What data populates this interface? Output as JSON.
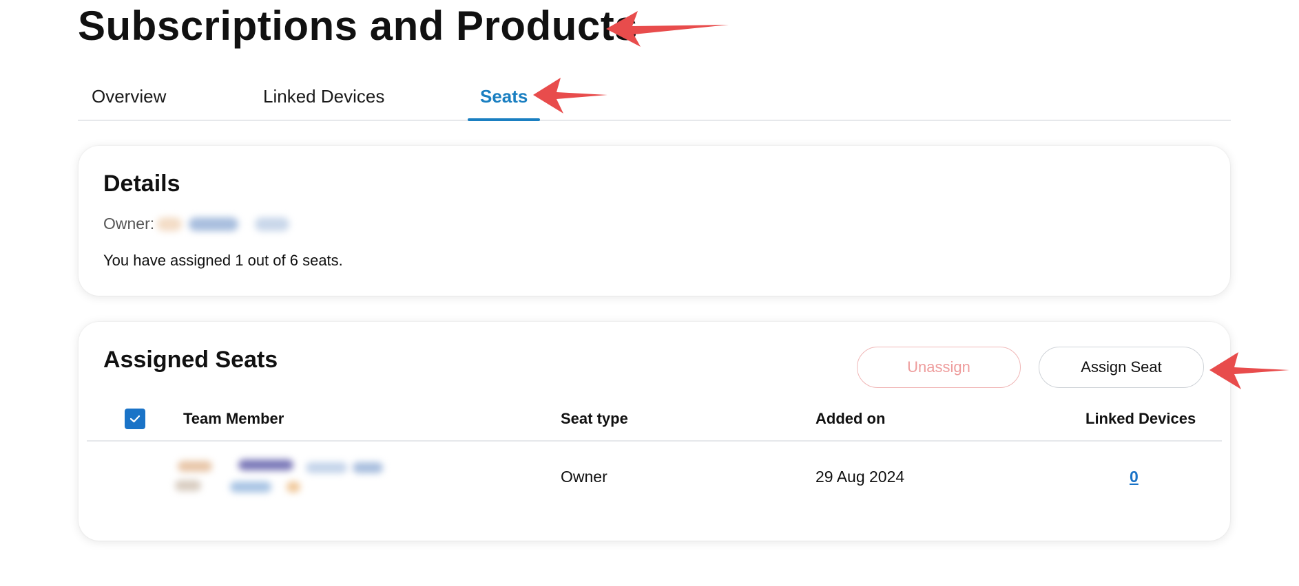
{
  "page": {
    "title": "Subscriptions and Products"
  },
  "tabs": [
    {
      "label": "Overview",
      "active": false
    },
    {
      "label": "Linked Devices",
      "active": false
    },
    {
      "label": "Seats",
      "active": true
    }
  ],
  "details": {
    "title": "Details",
    "owner_label": "Owner:",
    "assigned_text": "You have assigned 1 out of 6 seats."
  },
  "assigned_seats": {
    "title": "Assigned Seats",
    "unassign_label": "Unassign",
    "assign_label": "Assign Seat",
    "columns": [
      "Team Member",
      "Seat type",
      "Added on",
      "Linked Devices"
    ],
    "rows": [
      {
        "seat_type": "Owner",
        "added_on": "29 Aug 2024",
        "linked_devices": "0"
      }
    ]
  },
  "colors": {
    "accent": "#1a7fc1",
    "checkbox": "#1a73c7",
    "unassign_text": "#ee9c9c",
    "annotation_arrow": "#e84c4c"
  },
  "icons": [
    "checkmark-icon",
    "annotation-arrow-icon"
  ]
}
